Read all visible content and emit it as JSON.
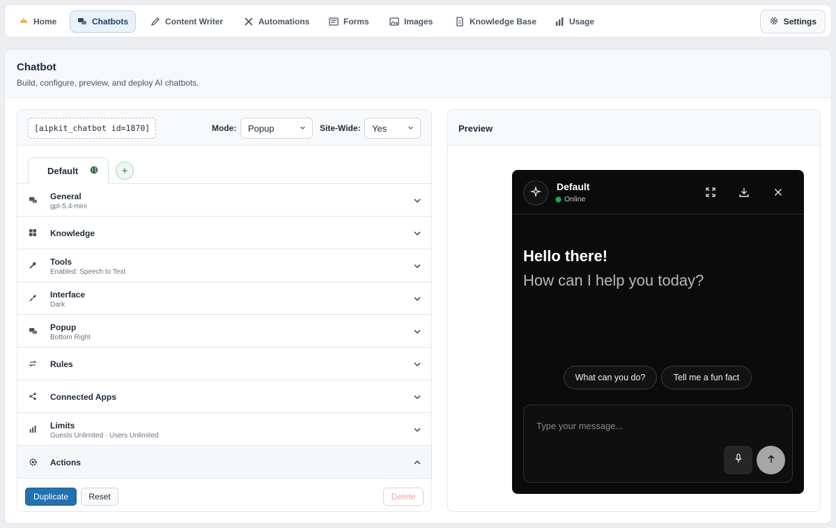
{
  "nav": {
    "items": [
      {
        "label": "Home",
        "icon": "sun-icon"
      },
      {
        "label": "Chatbots",
        "icon": "chat-bubbles-icon",
        "active": true
      },
      {
        "label": "Content Writer",
        "icon": "pencil-icon"
      },
      {
        "label": "Automations",
        "icon": "tools-icon"
      },
      {
        "label": "Forms",
        "icon": "form-icon"
      },
      {
        "label": "Images",
        "icon": "image-icon"
      },
      {
        "label": "Knowledge Base",
        "icon": "document-icon"
      },
      {
        "label": "Usage",
        "icon": "bar-chart-icon"
      }
    ],
    "settings_label": "Settings"
  },
  "page": {
    "title": "Chatbot",
    "subtitle": "Build, configure, preview, and deploy AI chatbots."
  },
  "toolbar": {
    "shortcode": "[aipkit_chatbot id=1870]",
    "mode_label": "Mode:",
    "mode_value": "Popup",
    "sitewide_label": "Site-Wide:",
    "sitewide_value": "Yes"
  },
  "tabs": {
    "default_label": "Default",
    "add_label": "+"
  },
  "sections": [
    {
      "title": "General",
      "subtitle": "gpt-5.4-mini",
      "icon": "chat-bubbles-icon"
    },
    {
      "title": "Knowledge",
      "subtitle": "",
      "icon": "table-icon"
    },
    {
      "title": "Tools",
      "subtitle": "Enabled: Speech to Text",
      "icon": "wrench-icon"
    },
    {
      "title": "Interface",
      "subtitle": "Dark",
      "icon": "brush-icon"
    },
    {
      "title": "Popup",
      "subtitle": "Bottom Right",
      "icon": "chat-bubbles-icon"
    },
    {
      "title": "Rules",
      "subtitle": "",
      "icon": "swap-icon"
    },
    {
      "title": "Connected Apps",
      "subtitle": "",
      "icon": "share-icon"
    },
    {
      "title": "Limits",
      "subtitle": "Guests Unlimited · Users Unlimited",
      "icon": "bar-chart-icon"
    },
    {
      "title": "Actions",
      "subtitle": "",
      "icon": "gear-icon"
    }
  ],
  "actions": {
    "duplicate_label": "Duplicate",
    "reset_label": "Reset",
    "delete_label": "Delete"
  },
  "preview": {
    "title": "Preview",
    "chat": {
      "bot_name": "Default",
      "status": "Online",
      "greeting": "Hello there!",
      "prompt": "How can I help you today?",
      "suggestions": [
        "What can you do?",
        "Tell me a fun fact"
      ],
      "input_placeholder": "Type your message..."
    }
  },
  "colors": {
    "accent": "#2271b1",
    "online": "#22a45d",
    "chat_bg": "#0b0b0b"
  }
}
